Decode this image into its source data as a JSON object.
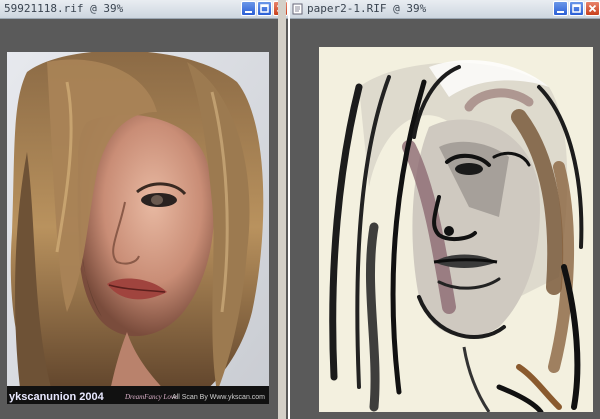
{
  "windows": [
    {
      "title": "59921118.rif @ 39%",
      "photo_caption": {
        "logo_text": "ykscanunion 2004",
        "signature_text": "DreamFancy Love",
        "url_text": "All Scan By Www.ykscan.com"
      }
    },
    {
      "title": "paper2-1.RIF @ 39%"
    }
  ],
  "colors": {
    "workspace": "#5a5a5a",
    "canvas_paper": "#f3f0df",
    "titlebar": "#dbe2ea",
    "control_blue": "#2b5fd6",
    "control_red": "#c8401c"
  },
  "icons": [
    "document-icon",
    "minimize-icon",
    "maximize-icon",
    "close-icon"
  ]
}
